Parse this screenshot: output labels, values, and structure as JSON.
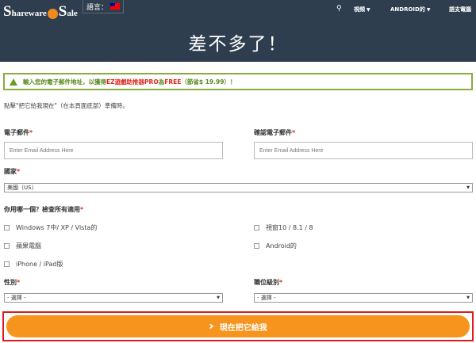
{
  "header": {
    "logo_text": {
      "s": "S",
      "mid1": "hareware",
      "o": "O",
      "n": "n",
      "s2": "S",
      "ale": "ale"
    },
    "lang_label": "語言：",
    "nav": {
      "search_icon": "search-icon",
      "video": "視頻",
      "android": "ANDROID的",
      "support": "語支電腦"
    },
    "title": "差不多了！"
  },
  "alert": {
    "text1": "輸入您的電子郵件地址，以獲得",
    "highlight1": "EZ遊戲助推器PRO",
    "text2": "為",
    "highlight2": "FREE",
    "text3": "（節省$ 19.99）！"
  },
  "intro": "點擊\"把它給我現在\"（在本頁面底部）準備時。",
  "form": {
    "email_label": "電子郵件",
    "email_placeholder": "Enter Email Address Here",
    "confirm_label": "確認電子郵件",
    "confirm_placeholder": "Enter Email Address Here",
    "country_label": "國家",
    "country_value": "美國（US）",
    "os_label": "你用哪一個？檢查所有適用",
    "os_options": [
      "Windows 7中/ XP / Vista的",
      "視窗10 / 8.1 / 8",
      "蘋果電腦",
      "Android的",
      "iPhone / iPad版"
    ],
    "gender_label": "性別",
    "gender_value": "- 選擇 -",
    "job_label": "職位級別",
    "job_value": "- 選擇 -",
    "required_mark": "*"
  },
  "submit_label": "現在把它給我",
  "colors": {
    "header_bg": "#2f3e4e",
    "accent": "#f7941d",
    "alert_border": "#8aac3e",
    "red": "#e0261b"
  }
}
